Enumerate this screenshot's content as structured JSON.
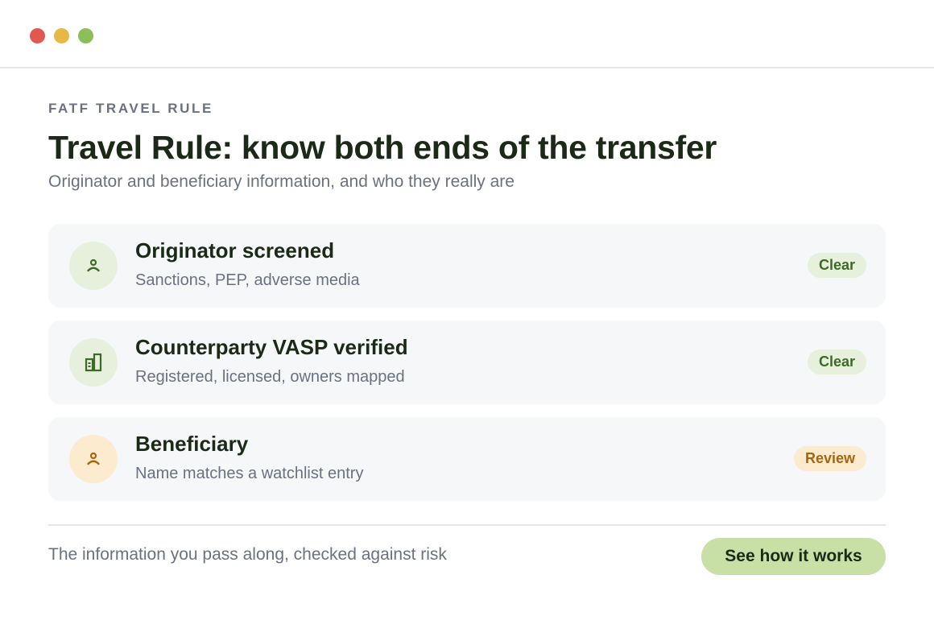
{
  "window": {
    "controls": [
      "close",
      "minimize",
      "maximize"
    ]
  },
  "header": {
    "eyebrow": "FATF TRAVEL RULE",
    "title": "Travel Rule: know both ends of the transfer",
    "subtitle": "Originator and beneficiary information, and who they really are"
  },
  "checks": [
    {
      "title": "Originator screened",
      "subtitle": "Sanctions, PEP, adverse media",
      "status": "Clear",
      "icon": "person-icon",
      "status_color": "#3d6b26"
    },
    {
      "title": "Counterparty VASP verified",
      "subtitle": "Registered, licensed, owners mapped",
      "status": "Clear",
      "icon": "building-icon",
      "status_color": "#3d6b26"
    },
    {
      "title": "Beneficiary",
      "subtitle": "Name matches a watchlist entry",
      "status": "Review",
      "icon": "person-icon",
      "status_color": "#a8650f"
    }
  ],
  "footer": {
    "text": "The information you pass along, checked against risk",
    "cta_label": "See how it works"
  },
  "colors": {
    "accent": "#c8dfa5",
    "ok": "#3d6b26",
    "warn": "#a8650f"
  }
}
